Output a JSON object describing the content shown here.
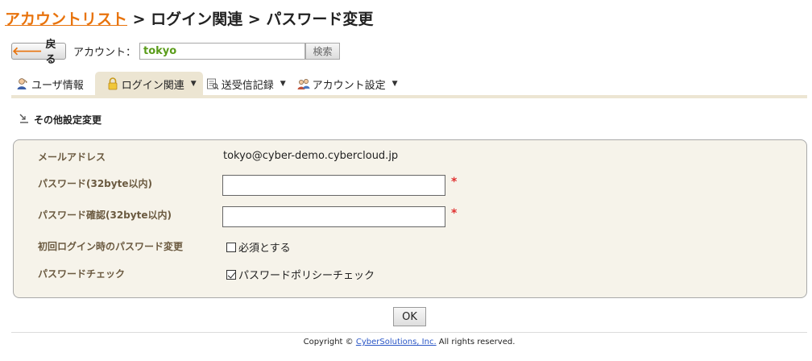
{
  "breadcrumb": {
    "root": "アカウントリスト",
    "sep1": " > ",
    "level2": "ログイン関連",
    "sep2": " > ",
    "current": "パスワード変更"
  },
  "toolbar": {
    "back_label": "戻る",
    "account_label": "アカウント：",
    "account_value": "tokyo",
    "search_label": "検索"
  },
  "tabs": [
    {
      "label": "ユーザ情報",
      "icon": "user-icon"
    },
    {
      "label": "ログイン関連",
      "icon": "lock-icon",
      "active": true
    },
    {
      "label": "送受信記録",
      "icon": "log-icon"
    },
    {
      "label": "アカウント設定",
      "icon": "users-icon"
    }
  ],
  "section": {
    "title": "その他設定変更"
  },
  "form": {
    "email_label": "メールアドレス",
    "email_value": "tokyo@cyber-demo.cybercloud.jp",
    "password_label": "パスワード(32byte以内)",
    "password_confirm_label": "パスワード確認(32byte以内)",
    "required_mark": "*",
    "first_login_label": "初回ログイン時のパスワード変更",
    "first_login_option": "必須とする",
    "first_login_checked": false,
    "password_check_label": "パスワードチェック",
    "password_check_option": "パスワードポリシーチェック",
    "password_check_checked": true
  },
  "ok_label": "OK",
  "footer": {
    "prefix": "Copyright © ",
    "company": "CyberSolutions, Inc.",
    "suffix": " All rights reserved."
  },
  "colors": {
    "link_orange": "#e8730c",
    "tab_bg": "#ece5d2",
    "panel_bg": "#f6f3ea",
    "label_brown": "#6b5a40",
    "required_red": "#e03030"
  }
}
